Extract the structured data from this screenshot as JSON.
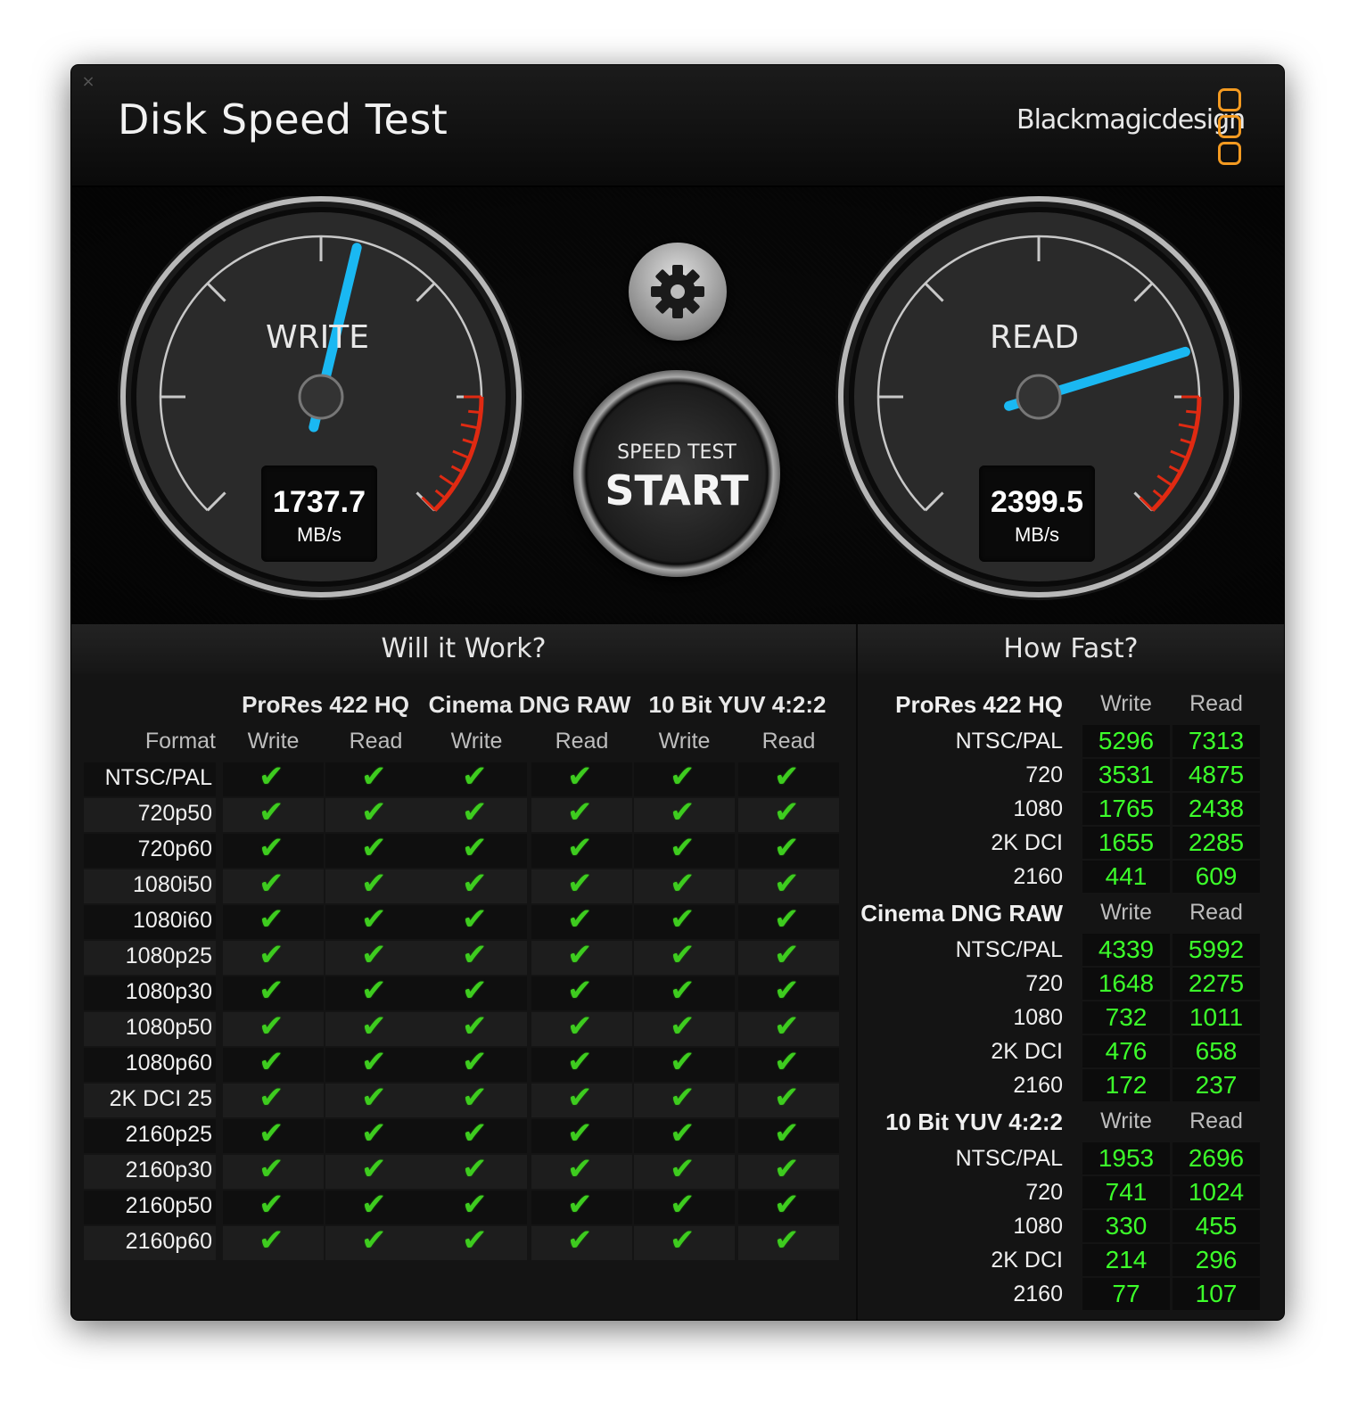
{
  "window": {
    "title": "Disk Speed Test",
    "brand": "Blackmagicdesign",
    "close_label": "×"
  },
  "gauges": {
    "write": {
      "label": "WRITE",
      "value": "1737.7",
      "unit": "MB/s",
      "needle_fraction": 0.55
    },
    "read": {
      "label": "READ",
      "value": "2399.5",
      "unit": "MB/s",
      "needle_fraction": 0.77
    }
  },
  "start_button": {
    "top": "SPEED TEST",
    "main": "START"
  },
  "sections": {
    "will_it_work": "Will it Work?",
    "how_fast": "How Fast?"
  },
  "will_it_work": {
    "format_label": "Format",
    "codecs": [
      "ProRes 422 HQ",
      "Cinema DNG RAW",
      "10 Bit YUV 4:2:2"
    ],
    "sub": [
      "Write",
      "Read"
    ],
    "check_glyph": "✔",
    "formats": [
      "NTSC/PAL",
      "720p50",
      "720p60",
      "1080i50",
      "1080i60",
      "1080p25",
      "1080p30",
      "1080p50",
      "1080p60",
      "2K DCI 25",
      "2160p25",
      "2160p30",
      "2160p50",
      "2160p60"
    ],
    "results": [
      [
        true,
        true,
        true,
        true,
        true,
        true
      ],
      [
        true,
        true,
        true,
        true,
        true,
        true
      ],
      [
        true,
        true,
        true,
        true,
        true,
        true
      ],
      [
        true,
        true,
        true,
        true,
        true,
        true
      ],
      [
        true,
        true,
        true,
        true,
        true,
        true
      ],
      [
        true,
        true,
        true,
        true,
        true,
        true
      ],
      [
        true,
        true,
        true,
        true,
        true,
        true
      ],
      [
        true,
        true,
        true,
        true,
        true,
        true
      ],
      [
        true,
        true,
        true,
        true,
        true,
        true
      ],
      [
        true,
        true,
        true,
        true,
        true,
        true
      ],
      [
        true,
        true,
        true,
        true,
        true,
        true
      ],
      [
        true,
        true,
        true,
        true,
        true,
        true
      ],
      [
        true,
        true,
        true,
        true,
        true,
        true
      ],
      [
        true,
        true,
        true,
        true,
        true,
        true
      ]
    ]
  },
  "how_fast": {
    "groups": [
      {
        "title": "ProRes 422 HQ",
        "write": "Write",
        "read": "Read",
        "rows": [
          [
            "NTSC/PAL",
            "5296",
            "7313"
          ],
          [
            "720",
            "3531",
            "4875"
          ],
          [
            "1080",
            "1765",
            "2438"
          ],
          [
            "2K DCI",
            "1655",
            "2285"
          ],
          [
            "2160",
            "441",
            "609"
          ]
        ]
      },
      {
        "title": "Cinema DNG RAW",
        "write": "Write",
        "read": "Read",
        "rows": [
          [
            "NTSC/PAL",
            "4339",
            "5992"
          ],
          [
            "720",
            "1648",
            "2275"
          ],
          [
            "1080",
            "732",
            "1011"
          ],
          [
            "2K DCI",
            "476",
            "658"
          ],
          [
            "2160",
            "172",
            "237"
          ]
        ]
      },
      {
        "title": "10 Bit YUV 4:2:2",
        "write": "Write",
        "read": "Read",
        "rows": [
          [
            "NTSC/PAL",
            "1953",
            "2696"
          ],
          [
            "720",
            "741",
            "1024"
          ],
          [
            "1080",
            "330",
            "455"
          ],
          [
            "2K DCI",
            "214",
            "296"
          ],
          [
            "2160",
            "77",
            "107"
          ]
        ]
      }
    ]
  },
  "colors": {
    "accent_needle": "#1ab8f2",
    "ok_check": "#3ecc1f",
    "value_green": "#3cff2a",
    "brand_orange": "#f39a21",
    "redline": "#e02a12"
  }
}
